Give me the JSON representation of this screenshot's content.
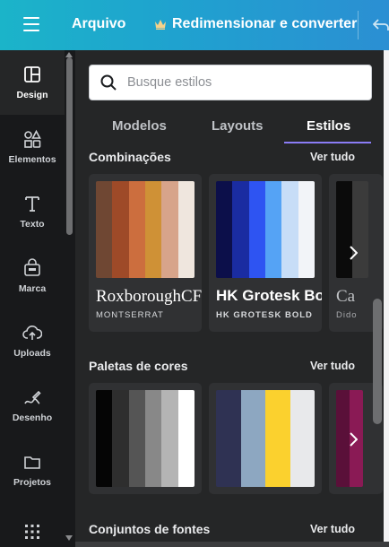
{
  "topbar": {
    "file_label": "Arquivo",
    "resize_label": "Redimensionar e converter"
  },
  "nav": {
    "items": [
      {
        "label": "Design",
        "icon": "layout-icon",
        "active": true
      },
      {
        "label": "Elementos",
        "icon": "shapes-icon"
      },
      {
        "label": "Texto",
        "icon": "text-icon"
      },
      {
        "label": "Marca",
        "icon": "brand-icon"
      },
      {
        "label": "Uploads",
        "icon": "cloud-upload-icon"
      },
      {
        "label": "Desenho",
        "icon": "draw-icon"
      },
      {
        "label": "Projetos",
        "icon": "folder-icon"
      },
      {
        "label": "",
        "icon": "apps-grid-icon"
      }
    ]
  },
  "search": {
    "placeholder": "Busque estilos"
  },
  "tabs": [
    {
      "label": "Modelos"
    },
    {
      "label": "Layouts"
    },
    {
      "label": "Estilos",
      "active": true
    }
  ],
  "sections": {
    "combinations": {
      "title": "Combinações",
      "see_all": "Ver tudo",
      "cards": [
        {
          "title": "RoxboroughCF",
          "subtitle": "MONTSERRAT",
          "colors": [
            "#6f4733",
            "#9e4a28",
            "#cc6e3e",
            "#cf9136",
            "#d7a48a",
            "#efe6de"
          ]
        },
        {
          "title": "HK Grotesk Bold",
          "subtitle": "HK GROTESK BOLD",
          "colors": [
            "#0c0f4a",
            "#1a2ca1",
            "#2e54f2",
            "#55a3f5",
            "#c7ddf7",
            "#f2f4f8"
          ]
        },
        {
          "title": "Ca",
          "subtitle": "Dido",
          "colors": [
            "#0b0b0b",
            "#3b3b3b"
          ]
        }
      ]
    },
    "palettes": {
      "title": "Paletas de cores",
      "see_all": "Ver tudo",
      "cards": [
        {
          "colors": [
            "#050505",
            "#2e2e2e",
            "#555555",
            "#888888",
            "#b4b4b4",
            "#ffffff"
          ]
        },
        {
          "colors": [
            "#2f3253",
            "#8da7c1",
            "#fbd12e",
            "#e8e9eb"
          ]
        },
        {
          "colors": [
            "#5a1039",
            "#8a1a55"
          ]
        }
      ]
    },
    "fonts": {
      "title": "Conjuntos de fontes",
      "see_all": "Ver tudo"
    }
  }
}
